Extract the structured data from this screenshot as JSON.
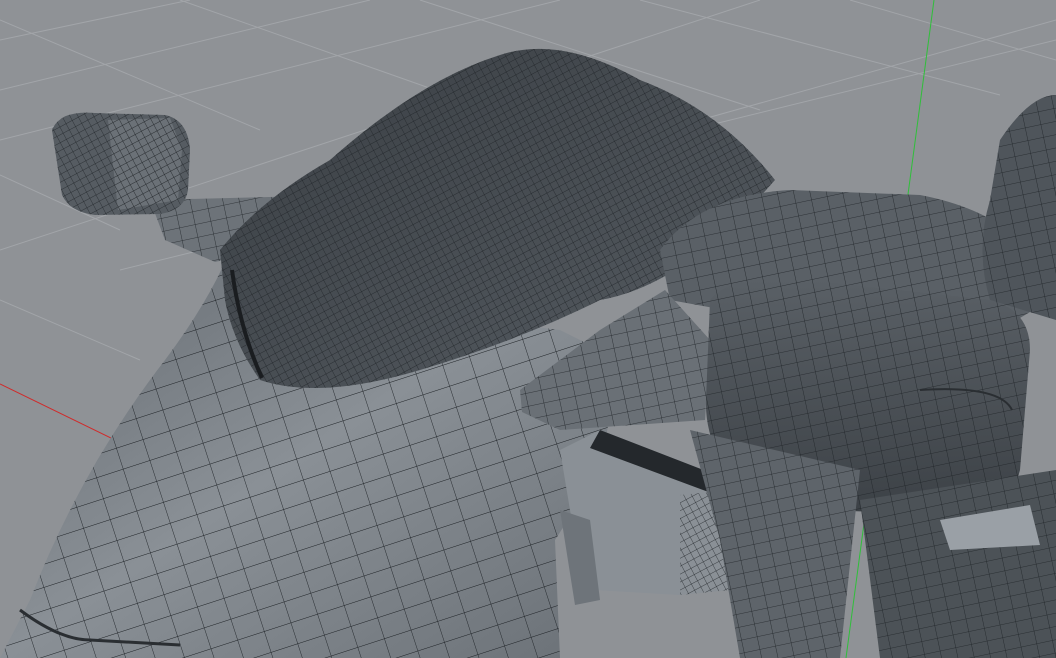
{
  "viewport": {
    "background_color": "#8f9296",
    "grid_color": "#a2a5a9",
    "x_axis_color": "#d02a2a",
    "y_axis_color": "#2fbf3a",
    "mesh_fill_color": "#4b5055",
    "mesh_fill_light_color": "#7c8288",
    "mesh_wire_color": "#1e2226",
    "show_grid": true,
    "show_wireframe": true,
    "objects": [
      "windscreen",
      "fairing-body",
      "left-mirror",
      "right-mirror",
      "headlight-box",
      "right-hand-grip",
      "fork-assembly"
    ]
  }
}
